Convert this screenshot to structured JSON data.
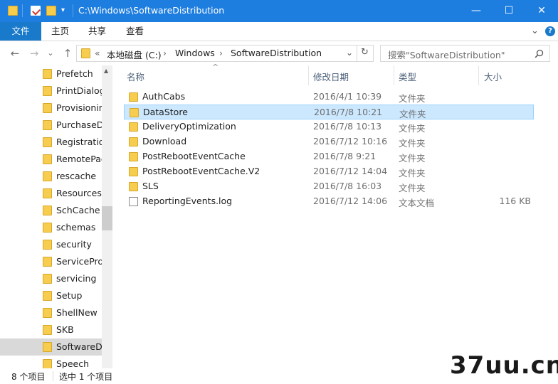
{
  "window": {
    "title": "C:\\Windows\\SoftwareDistribution",
    "minimize": "—",
    "maximize": "☐",
    "close": "✕"
  },
  "ribbon": {
    "tabs": [
      "文件",
      "主页",
      "共享",
      "查看"
    ],
    "expand": "⌄",
    "help": "?"
  },
  "address": {
    "overflow": "«",
    "crumbs": [
      "本地磁盘 (C:)",
      "Windows",
      "SoftwareDistribution"
    ],
    "separator": "›",
    "dropdown": "⌄",
    "refresh": "↻"
  },
  "search": {
    "placeholder": "搜索\"SoftwareDistribution\""
  },
  "nav": {
    "back": "←",
    "forward": "→",
    "recent": "⌄",
    "up": "↑",
    "items": [
      "Prefetch",
      "PrintDialog",
      "Provisioning",
      "PurchaseDialog",
      "Registration",
      "RemotePackages",
      "rescache",
      "Resources",
      "SchCache",
      "schemas",
      "security",
      "ServiceProfiles",
      "servicing",
      "Setup",
      "ShellNew",
      "SKB",
      "SoftwareDistribution",
      "Speech"
    ],
    "selected_index": 16
  },
  "columns": {
    "name": "名称",
    "date": "修改日期",
    "type": "类型",
    "size": "大小",
    "sort_indicator": "^"
  },
  "files": [
    {
      "name": "AuthCabs",
      "date": "2016/4/1 10:39",
      "type": "文件夹",
      "size": "",
      "kind": "folder"
    },
    {
      "name": "DataStore",
      "date": "2016/7/8 10:21",
      "type": "文件夹",
      "size": "",
      "kind": "folder"
    },
    {
      "name": "DeliveryOptimization",
      "date": "2016/7/8 10:13",
      "type": "文件夹",
      "size": "",
      "kind": "folder"
    },
    {
      "name": "Download",
      "date": "2016/7/12 10:16",
      "type": "文件夹",
      "size": "",
      "kind": "folder"
    },
    {
      "name": "PostRebootEventCache",
      "date": "2016/7/8 9:21",
      "type": "文件夹",
      "size": "",
      "kind": "folder"
    },
    {
      "name": "PostRebootEventCache.V2",
      "date": "2016/7/12 14:04",
      "type": "文件夹",
      "size": "",
      "kind": "folder"
    },
    {
      "name": "SLS",
      "date": "2016/7/8 16:03",
      "type": "文件夹",
      "size": "",
      "kind": "folder"
    },
    {
      "name": "ReportingEvents.log",
      "date": "2016/7/12 14:06",
      "type": "文本文档",
      "size": "116 KB",
      "kind": "file"
    }
  ],
  "selected_file_index": 1,
  "status": {
    "count": "8 个项目",
    "selected": "选中 1 个项目"
  },
  "watermark": "37uu.cn"
}
